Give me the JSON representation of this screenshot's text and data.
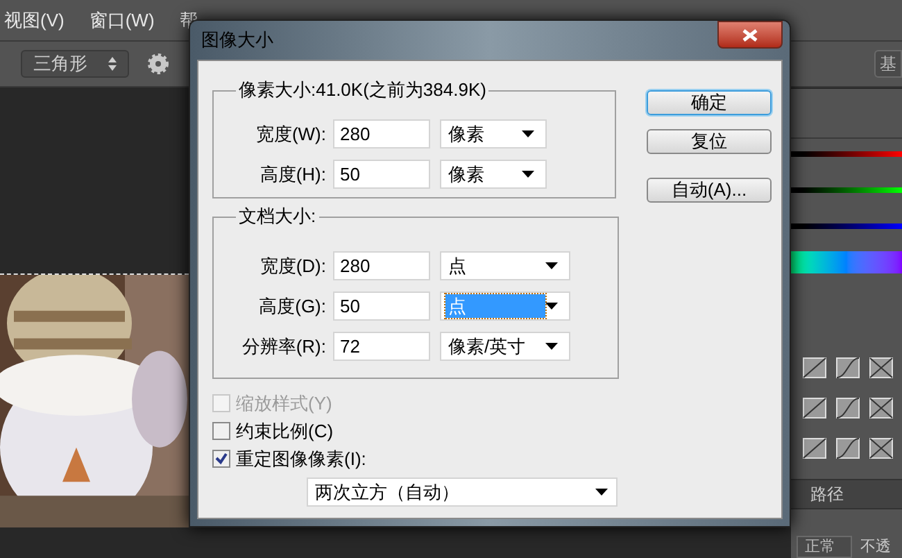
{
  "menu": [
    "视图(V)",
    "窗口(W)",
    "帮"
  ],
  "options_bar": {
    "shape_select": "三角形",
    "workspace_button": "基"
  },
  "dialog": {
    "title": "图像大小",
    "pixel_dimensions": {
      "legend": "像素大小:41.0K(之前为384.9K)",
      "fields": [
        {
          "label": "宽度(W):",
          "value": "280",
          "unit": "像素",
          "selected": false
        },
        {
          "label": "高度(H):",
          "value": "50",
          "unit": "像素",
          "selected": false
        }
      ]
    },
    "document_size": {
      "legend": "文档大小:",
      "fields": [
        {
          "label": "宽度(D):",
          "value": "280",
          "unit": "点",
          "selected": false
        },
        {
          "label": "高度(G):",
          "value": "50",
          "unit": "点",
          "selected": true
        },
        {
          "label": "分辨率(R):",
          "value": "72",
          "unit": "像素/英寸",
          "selected": false
        }
      ]
    },
    "checkboxes": [
      {
        "label": "缩放样式(Y)",
        "checked": false,
        "disabled": true
      },
      {
        "label": "约束比例(C)",
        "checked": false,
        "disabled": false
      },
      {
        "label": "重定图像像素(I):",
        "checked": true,
        "disabled": false
      }
    ],
    "resample_method": "两次立方（自动）",
    "buttons": [
      {
        "label": "确定",
        "default": true
      },
      {
        "label": "复位",
        "default": false
      },
      {
        "label": "自动(A)...",
        "default": false
      }
    ]
  },
  "right_panel": {
    "tab": "路径",
    "blend_mode": "正常",
    "opacity_label": "不透"
  }
}
